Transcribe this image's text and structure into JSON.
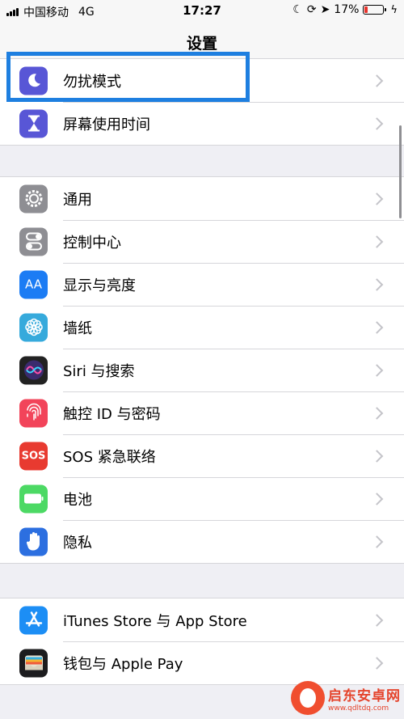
{
  "status_bar": {
    "carrier": "中国移动",
    "network": "4G",
    "time": "17:27",
    "battery_percent": "17%",
    "battery_level": 0.17,
    "battery_color": "#e8332c"
  },
  "nav": {
    "title": "设置"
  },
  "groups": [
    {
      "items": [
        {
          "label": "勿扰模式",
          "icon": "moon-icon",
          "color": "#5856d6"
        },
        {
          "label": "屏幕使用时间",
          "icon": "hourglass-icon",
          "color": "#5856d6"
        }
      ]
    },
    {
      "items": [
        {
          "label": "通用",
          "icon": "gear-icon",
          "color": "#8e8e93"
        },
        {
          "label": "控制中心",
          "icon": "toggles-icon",
          "color": "#8e8e93"
        },
        {
          "label": "显示与亮度",
          "icon": "text-size-icon",
          "icon_text": "AA",
          "color": "#1c7cf4"
        },
        {
          "label": "墙纸",
          "icon": "flower-icon",
          "color": "#36aadc"
        },
        {
          "label": "Siri 与搜索",
          "icon": "siri-icon",
          "color": "#222"
        },
        {
          "label": "触控 ID 与密码",
          "icon": "fingerprint-icon",
          "color": "#f2445a"
        },
        {
          "label": "SOS 紧急联络",
          "icon": "sos-icon",
          "icon_text": "SOS",
          "color": "#e83a30"
        },
        {
          "label": "电池",
          "icon": "battery-icon",
          "color": "#4cd964"
        },
        {
          "label": "隐私",
          "icon": "hand-icon",
          "color": "#2c6fe0"
        }
      ]
    },
    {
      "items": [
        {
          "label": "iTunes Store 与 App Store",
          "icon": "app-store-icon",
          "color": "#1c8ef5"
        },
        {
          "label": "钱包与 Apple Pay",
          "icon": "wallet-icon",
          "color": "#1c1c1e"
        }
      ]
    }
  ],
  "watermark": {
    "title": "启东安卓网",
    "url": "www.qdltdq.com"
  }
}
